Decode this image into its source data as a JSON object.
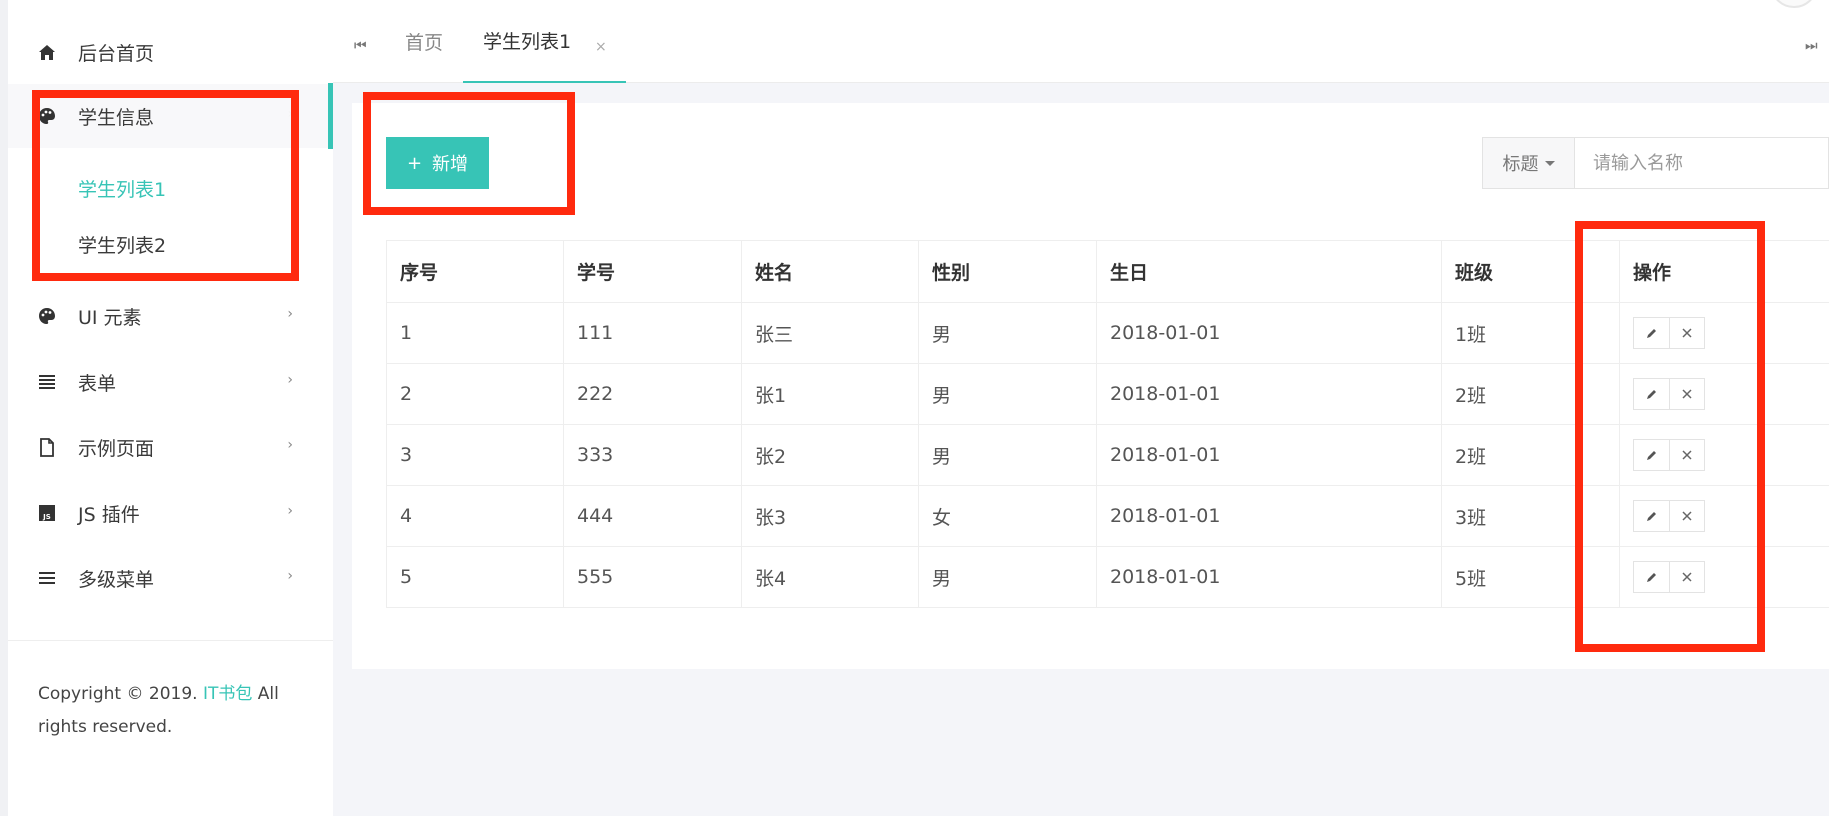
{
  "sidebar": {
    "items": [
      {
        "label": "后台首页",
        "icon": "home-icon"
      },
      {
        "label": "学生信息",
        "icon": "palette-icon",
        "expanded": true,
        "children": [
          {
            "label": "学生列表1",
            "current": true
          },
          {
            "label": "学生列表2",
            "current": false
          }
        ]
      },
      {
        "label": "UI 元素",
        "icon": "palette-icon"
      },
      {
        "label": "表单",
        "icon": "list-icon"
      },
      {
        "label": "示例页面",
        "icon": "file-icon"
      },
      {
        "label": "JS 插件",
        "icon": "js-icon"
      },
      {
        "label": "多级菜单",
        "icon": "bars-icon"
      }
    ],
    "footer": {
      "prefix": "Copyright © 2019.",
      "brand": "IT书包",
      "suffix": "All rights reserved."
    }
  },
  "tabs": {
    "items": [
      {
        "label": "首页"
      },
      {
        "label": "学生列表1",
        "active": true
      }
    ]
  },
  "toolbar": {
    "add_label": "新增",
    "search_field_label": "标题",
    "search_placeholder": "请输入名称"
  },
  "table": {
    "headers": [
      "序号",
      "学号",
      "姓名",
      "性别",
      "生日",
      "班级",
      "操作"
    ],
    "rows": [
      [
        "1",
        "111",
        "张三",
        "男",
        "2018-01-01",
        "1班"
      ],
      [
        "2",
        "222",
        "张1",
        "男",
        "2018-01-01",
        "2班"
      ],
      [
        "3",
        "333",
        "张2",
        "男",
        "2018-01-01",
        "2班"
      ],
      [
        "4",
        "444",
        "张3",
        "女",
        "2018-01-01",
        "3班"
      ],
      [
        "5",
        "555",
        "张4",
        "男",
        "2018-01-01",
        "5班"
      ]
    ]
  },
  "colors": {
    "accent": "#37c4b6",
    "highlight": "#ff2a0e"
  }
}
